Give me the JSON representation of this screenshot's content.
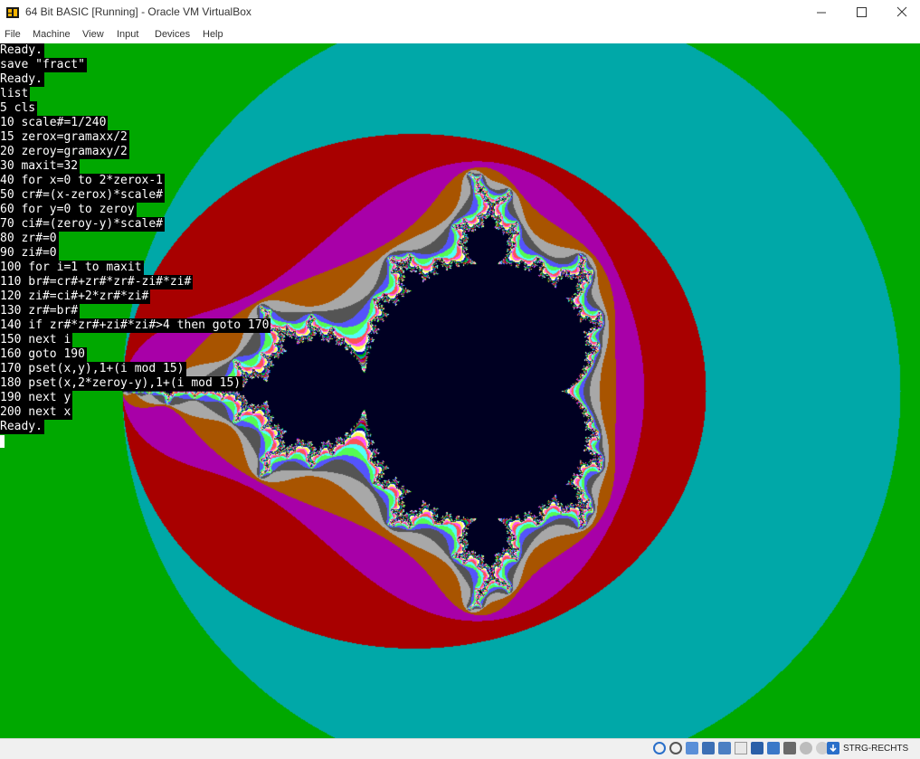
{
  "window": {
    "title": "64 Bit BASIC [Running] - Oracle VM VirtualBox"
  },
  "menu": {
    "items": [
      {
        "id": "file",
        "label": "File"
      },
      {
        "id": "machine",
        "label": "Machine"
      },
      {
        "id": "view",
        "label": "View"
      },
      {
        "id": "input",
        "label": "Input"
      },
      {
        "id": "devices",
        "label": "Devices"
      },
      {
        "id": "help",
        "label": "Help"
      }
    ]
  },
  "console": {
    "lines": [
      "Ready.",
      "save \"fract\"",
      "Ready.",
      "list",
      "5 cls",
      "10 scale#=1/240",
      "15 zerox=gramaxx/2",
      "20 zeroy=gramaxy/2",
      "30 maxit=32",
      "40 for x=0 to 2*zerox-1",
      "50 cr#=(x-zerox)*scale#",
      "60 for y=0 to zeroy",
      "70 ci#=(zeroy-y)*scale#",
      "80 zr#=0",
      "90 zi#=0",
      "100 for i=1 to maxit",
      "110 br#=cr#+zr#*zr#-zi#*zi#",
      "120 zi#=ci#+2*zr#*zi#",
      "130 zr#=br#",
      "140 if zr#*zr#+zi#*zi#>4 then goto 170",
      "150 next i",
      "160 goto 190",
      "170 pset(x,y),1+(i mod 15)",
      "180 pset(x,2*zeroy-y),1+(i mod 15)",
      "190 next y",
      "200 next x",
      "Ready."
    ]
  },
  "statusbar": {
    "host_key": "STRG-RECHTS",
    "icons": [
      "hard-disk-icon",
      "optical-drive-icon",
      "audio-icon",
      "network-icon",
      "usb-icon",
      "shared-folders-icon",
      "display-icon",
      "video-capture-icon",
      "cpu-icon",
      "mouse-integration-icon",
      "keyboard-capture-icon"
    ]
  },
  "colors": {
    "screen_background": "#00a800",
    "fractal_inner": "#000022",
    "console_text": "#ffffff",
    "console_background": "#000000"
  },
  "fractal": {
    "max_iterations": 32,
    "palette": [
      "#000000",
      "#0000a8",
      "#00a800",
      "#00a8a8",
      "#a80000",
      "#a800a8",
      "#a85400",
      "#a8a8a8",
      "#545454",
      "#5454fc",
      "#54fc54",
      "#54fcfc",
      "#fc5454",
      "#fc54fc",
      "#fcfc54",
      "#fcfcfc"
    ]
  }
}
